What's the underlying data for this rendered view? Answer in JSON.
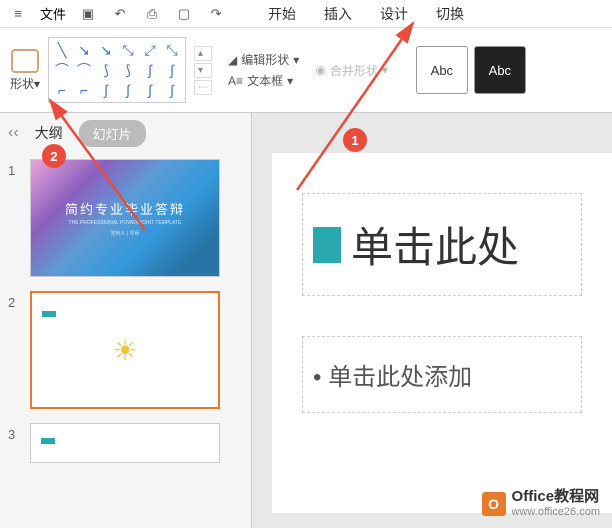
{
  "toolbar": {
    "menu_file": "文件",
    "tabs": {
      "start": "开始",
      "insert": "插入",
      "design": "设计",
      "transition": "切换"
    }
  },
  "ribbon": {
    "shape_label": "形状",
    "edit_shape": "编辑形状",
    "textbox": "文本框",
    "merge_shape": "合并形状",
    "style_abc1": "Abc",
    "style_abc2": "Abc"
  },
  "sidebar": {
    "outline_tab": "大纲",
    "slides_tab": "幻灯片",
    "slides": [
      {
        "num": "1",
        "title": "简约专业毕业答辩",
        "sub": "THE PROFESSIONAL POWERPOINT TEMPLATE",
        "bot": "答辩人 | 导师"
      },
      {
        "num": "2"
      },
      {
        "num": "3"
      }
    ]
  },
  "canvas": {
    "title": "单击此处",
    "bullet": "• 单击此处添加"
  },
  "annotations": {
    "badge1": "1",
    "badge2": "2"
  },
  "watermark": {
    "brand_en": "Office",
    "brand_cn": "教程网",
    "url": "www.office26.com"
  }
}
